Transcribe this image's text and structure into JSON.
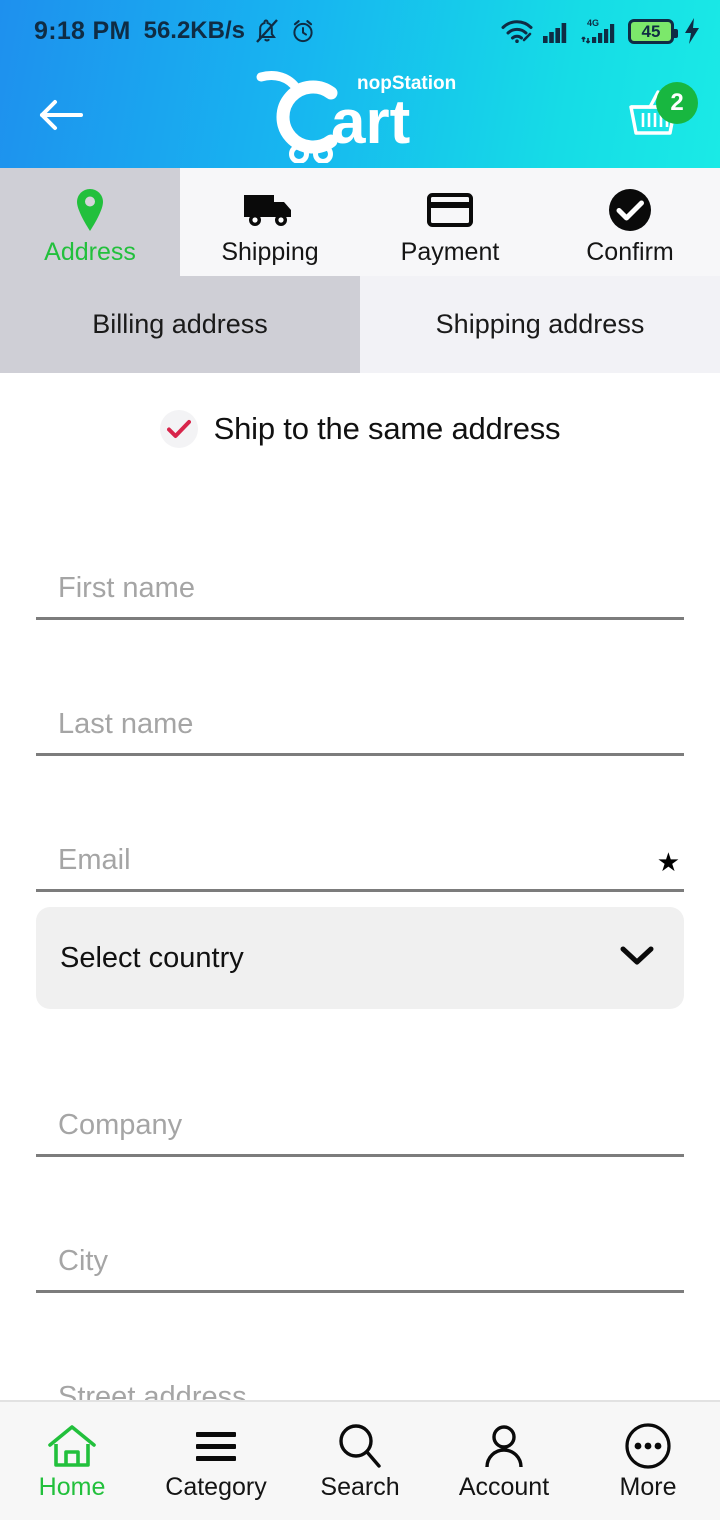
{
  "status_bar": {
    "time": "9:18 PM",
    "network_speed": "56.2KB/s",
    "mute_icon": "bell-muted-icon",
    "alarm_icon": "alarm-clock-icon",
    "wifi_icon": "wifi-icon",
    "signal_icon": "signal-bars-icon",
    "network_type": "4G",
    "battery_level": "45",
    "charging_icon": "charging-bolt-icon",
    "battery_color": "#7CE86B"
  },
  "app_bar": {
    "back_icon": "back-arrow-icon",
    "logo_top_text": "nopStation",
    "logo_main_text": "art",
    "logo_cart_letter": "C",
    "cart_icon": "shopping-basket-icon",
    "cart_count": "2",
    "cart_badge_color": "#18B740",
    "gradient_start": "#1E90EE",
    "gradient_end": "#1AEAE6"
  },
  "steps": {
    "active_color": "#22C03C",
    "active_bg": "#CFCFD6",
    "items": [
      {
        "label": "Address",
        "icon": "location-pin-icon",
        "active": true
      },
      {
        "label": "Shipping",
        "icon": "delivery-truck-icon",
        "active": false
      },
      {
        "label": "Payment",
        "icon": "credit-card-icon",
        "active": false
      },
      {
        "label": "Confirm",
        "icon": "check-circle-icon",
        "active": false
      }
    ]
  },
  "address_tabs": {
    "items": [
      {
        "label": "Billing address",
        "active": true
      },
      {
        "label": "Shipping address",
        "active": false
      }
    ]
  },
  "form": {
    "same_address": {
      "label": "Ship to the same address",
      "checked": true,
      "check_color": "#D8254B"
    },
    "fields": [
      {
        "name": "first-name",
        "placeholder": "First name",
        "value": "",
        "required": false
      },
      {
        "name": "last-name",
        "placeholder": "Last name",
        "value": "",
        "required": false
      },
      {
        "name": "email",
        "placeholder": "Email",
        "value": "",
        "required": true,
        "required_marker": "★"
      }
    ],
    "country_select": {
      "name": "country",
      "value": "Select country",
      "chevron_icon": "chevron-down-icon"
    },
    "fields_after": [
      {
        "name": "company",
        "placeholder": "Company",
        "value": "",
        "required": false
      },
      {
        "name": "city",
        "placeholder": "City",
        "value": "",
        "required": false
      },
      {
        "name": "street-address",
        "placeholder": "Street address",
        "value": "",
        "required": false
      }
    ]
  },
  "bottom_nav": {
    "active_color": "#22C03C",
    "items": [
      {
        "label": "Home",
        "icon": "home-icon",
        "active": true
      },
      {
        "label": "Category",
        "icon": "hamburger-menu-icon",
        "active": false
      },
      {
        "label": "Search",
        "icon": "search-icon",
        "active": false
      },
      {
        "label": "Account",
        "icon": "person-icon",
        "active": false
      },
      {
        "label": "More",
        "icon": "ellipsis-circle-icon",
        "active": false
      }
    ]
  }
}
